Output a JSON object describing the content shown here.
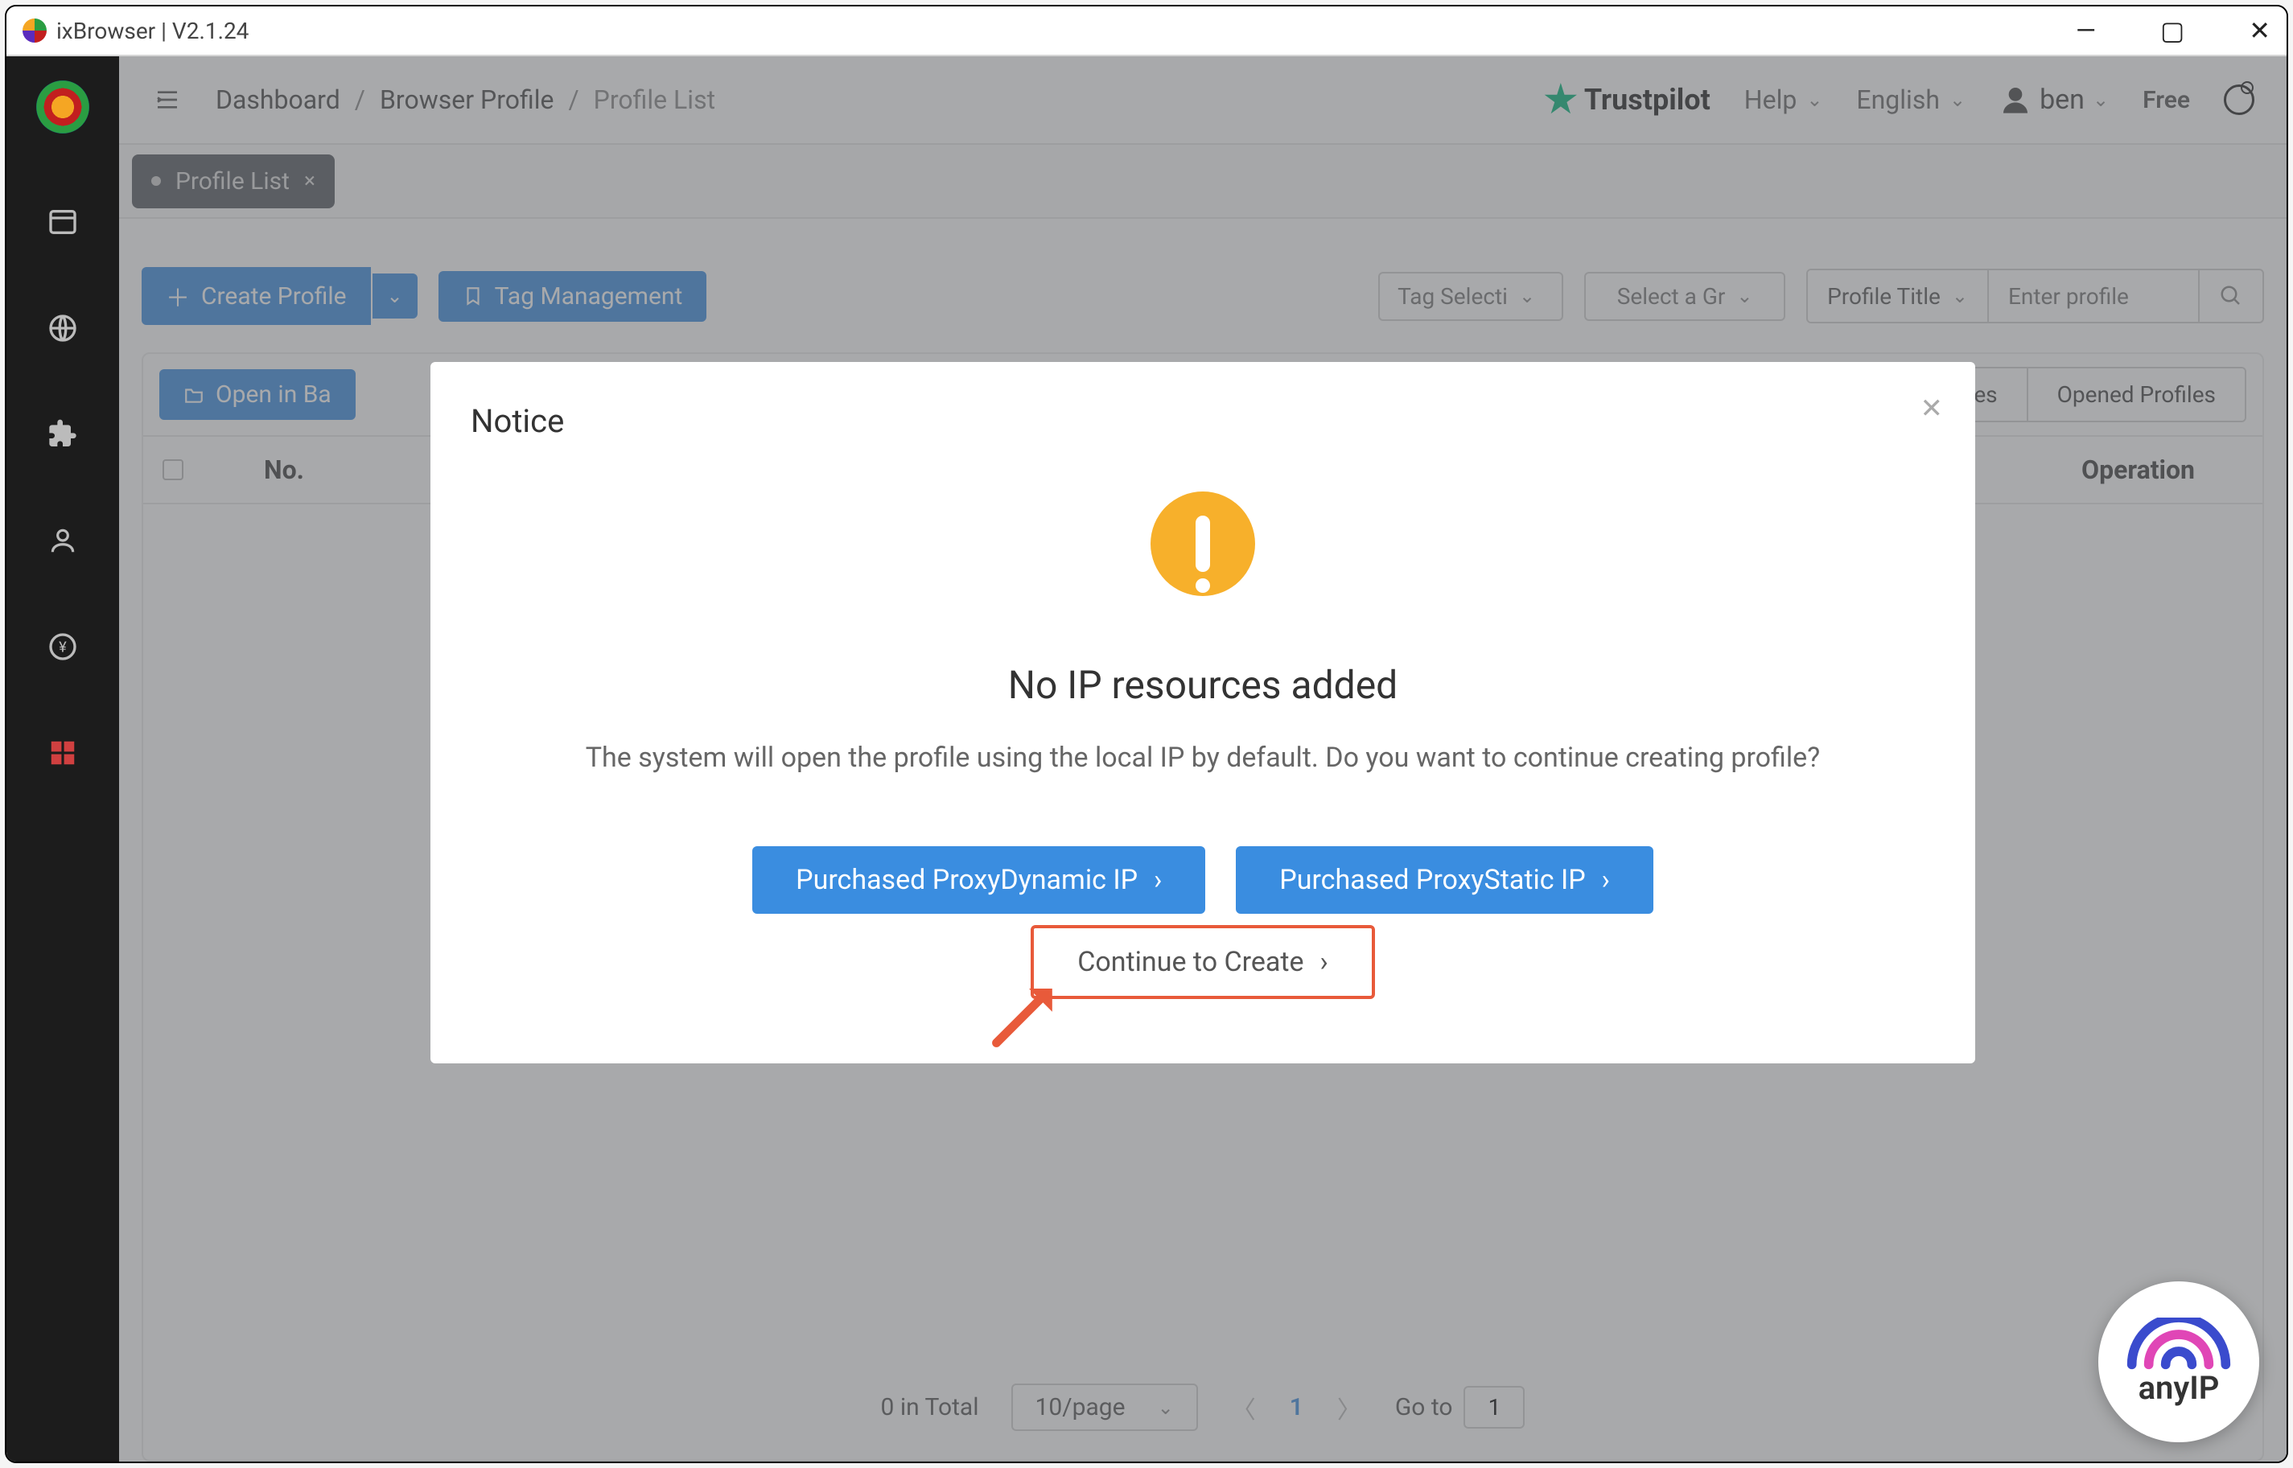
{
  "window": {
    "title": "ixBrowser | V2.1.24"
  },
  "breadcrumb": {
    "dashboard": "Dashboard",
    "browser_profile": "Browser Profile",
    "profile_list": "Profile List"
  },
  "header": {
    "trustpilot": "Trustpilot",
    "help": "Help",
    "language": "English",
    "user": "ben",
    "plan": "Free"
  },
  "tab": {
    "label": "Profile List"
  },
  "toolbar": {
    "create_profile": "Create Profile",
    "tag_management": "Tag Management",
    "tag_selection": "Tag Selecti",
    "select_group": "Select a Gr",
    "filter_field": "Profile Title",
    "search_placeholder": "Enter profile"
  },
  "second_toolbar": {
    "open_in": "Open in Ba",
    "batches": "es",
    "opened_profiles": "Opened Profiles"
  },
  "table": {
    "no": "No.",
    "operation": "Operation"
  },
  "pagination": {
    "total": "0 in Total",
    "per_page": "10/page",
    "current": "1",
    "goto_label": "Go to",
    "goto_value": "1"
  },
  "modal": {
    "title": "Notice",
    "headline": "No IP resources added",
    "subtext": "The system will open the profile using the local IP by default. Do you want to continue creating profile?",
    "btn_dynamic": "Purchased ProxyDynamic IP",
    "btn_static": "Purchased ProxyStatic IP",
    "btn_continue": "Continue to Create"
  },
  "watermark": {
    "label": "anyIP"
  }
}
